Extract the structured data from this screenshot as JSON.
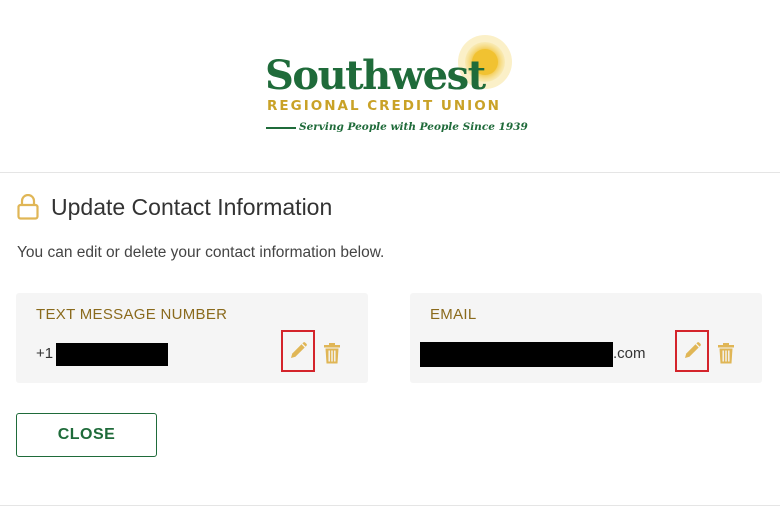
{
  "brand": {
    "name": "Southwest",
    "subtitle": "REGIONAL CREDIT UNION",
    "tagline": "Serving People with People Since 1939",
    "colors": {
      "green": "#1f6b3a",
      "gold": "#c9a227"
    }
  },
  "page": {
    "title": "Update Contact Information",
    "description": "You can edit or delete your contact information below.",
    "title_icon": "lock-icon"
  },
  "contacts": [
    {
      "label": "TEXT MESSAGE NUMBER",
      "value_prefix": "+1",
      "value_suffix": "",
      "edit_icon": "pencil-icon",
      "delete_icon": "trash-icon"
    },
    {
      "label": "EMAIL",
      "value_prefix": "",
      "value_suffix": ".com",
      "edit_icon": "pencil-icon",
      "delete_icon": "trash-icon"
    }
  ],
  "actions": {
    "close_label": "CLOSE"
  }
}
